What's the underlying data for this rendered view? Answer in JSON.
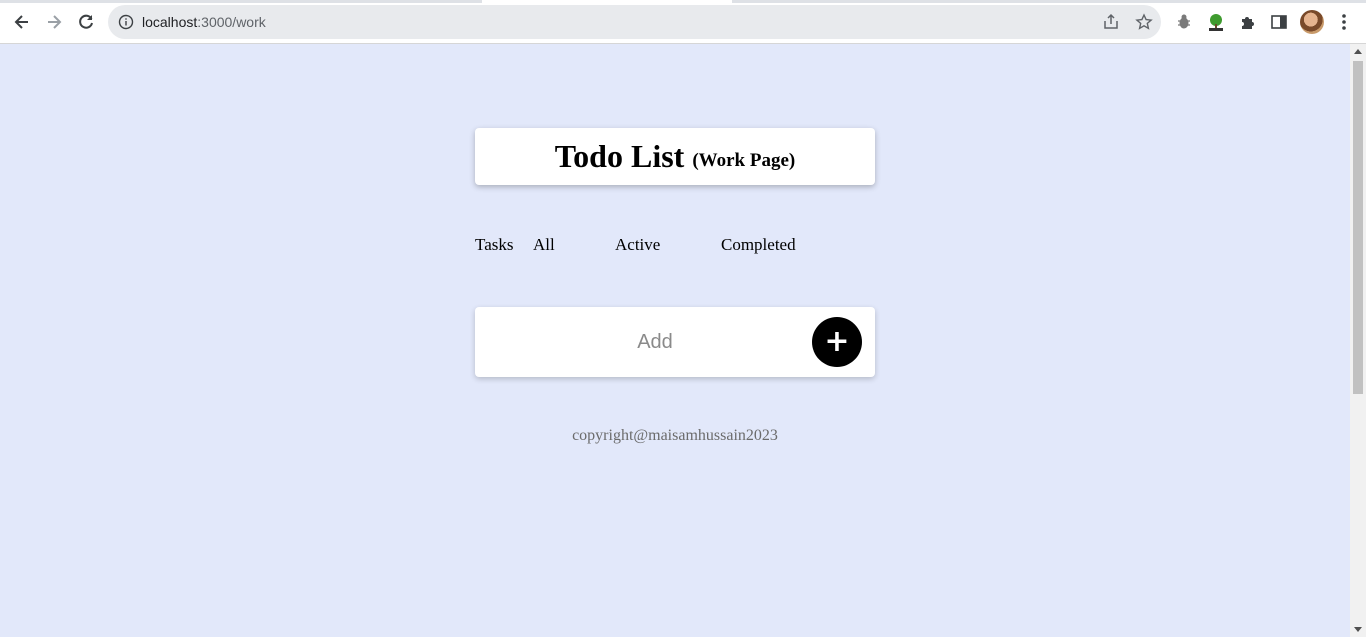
{
  "browser": {
    "url_host": "localhost",
    "url_path": ":3000/work"
  },
  "page": {
    "title": "Todo List",
    "subtitle": "(Work Page)",
    "tabs": {
      "label": "Tasks",
      "all": "All",
      "active": "Active",
      "completed": "Completed"
    },
    "add": {
      "placeholder": "Add",
      "button": "+"
    },
    "footer": "copyright@maisamhussain2023"
  },
  "colors": {
    "background": "#e2e8fa",
    "card": "#ffffff",
    "add_button": "#000000"
  }
}
